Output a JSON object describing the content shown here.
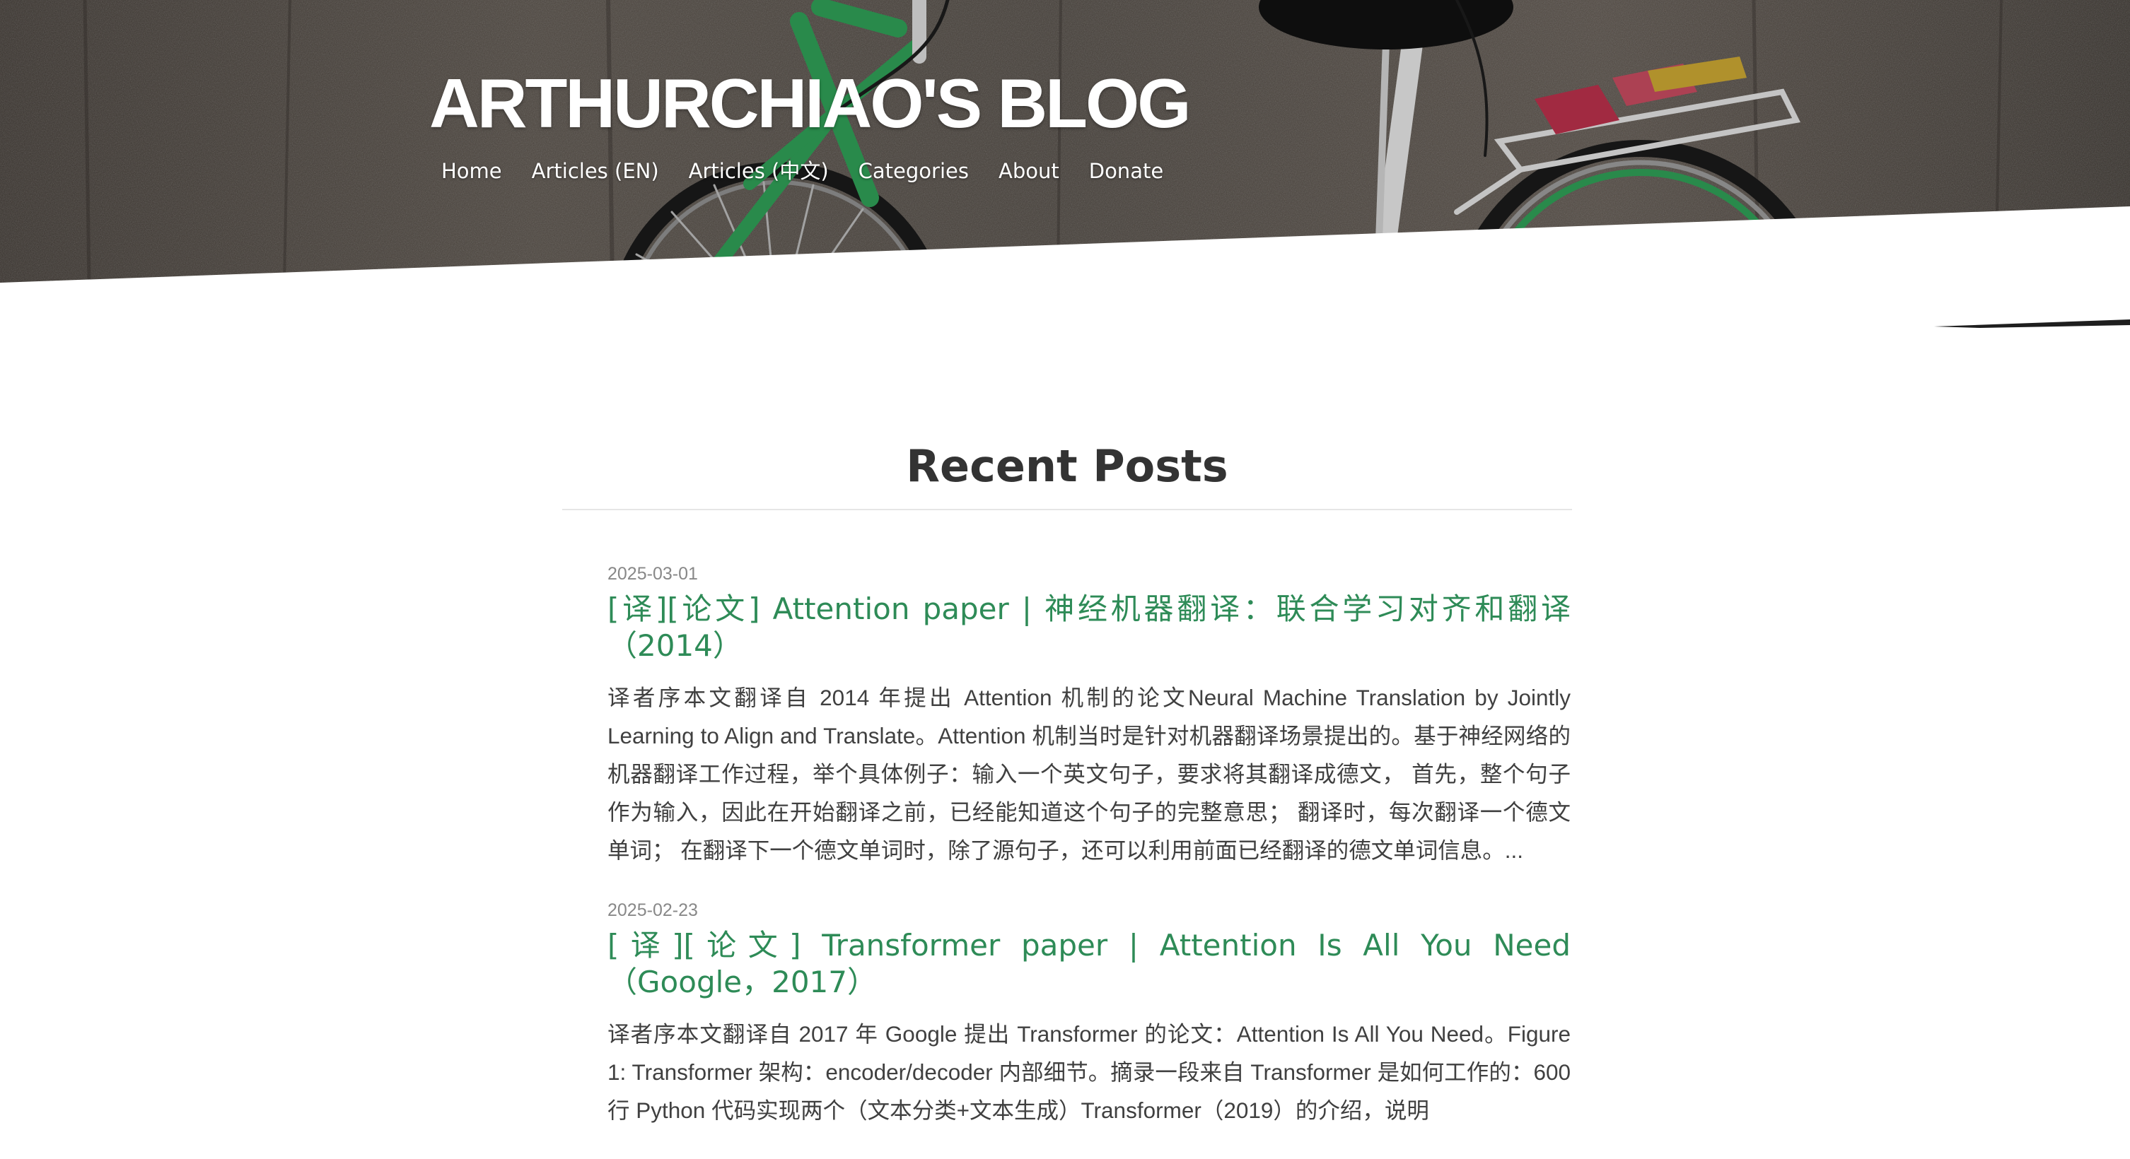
{
  "site": {
    "title": "ARTHURCHIAO'S BLOG"
  },
  "nav": {
    "items": [
      {
        "label": "Home"
      },
      {
        "label": "Articles (EN)"
      },
      {
        "label": "Articles (中文)"
      },
      {
        "label": "Categories"
      },
      {
        "label": "About"
      },
      {
        "label": "Donate"
      }
    ]
  },
  "main": {
    "section_title": "Recent Posts",
    "posts": [
      {
        "date": "2025-03-01",
        "title": "[译][论文] Attention paper | 神经机器翻译：联合学习对齐和翻译（2014）",
        "excerpt": "译者序本文翻译自 2014 年提出 Attention 机制的论文Neural Machine Translation by Jointly Learning to Align and Translate。Attention 机制当时是针对机器翻译场景提出的。基于神经网络的机器翻译工作过程，举个具体例子：输入一个英文句子，要求将其翻译成德文， 首先，整个句子作为输入，因此在开始翻译之前，已经能知道这个句子的完整意思； 翻译时，每次翻译一个德文单词； 在翻译下一个德文单词时，除了源句子，还可以利用前面已经翻译的德文单词信息。..."
      },
      {
        "date": "2025-02-23",
        "title": "[译][论文] Transformer paper | Attention Is All You Need（Google，2017）",
        "excerpt": "译者序本文翻译自 2017 年 Google 提出 Transformer 的论文：Attention Is All You Need。Figure 1: Transformer 架构：encoder/decoder 内部细节。摘录一段来自 Transformer 是如何工作的：600 行 Python 代码实现两个（文本分类+文本生成）Transformer（2019）的介绍，说明"
      }
    ]
  },
  "colors": {
    "accent": "#2e8b57",
    "text": "#404040",
    "heading": "#333333",
    "date": "#888888"
  }
}
